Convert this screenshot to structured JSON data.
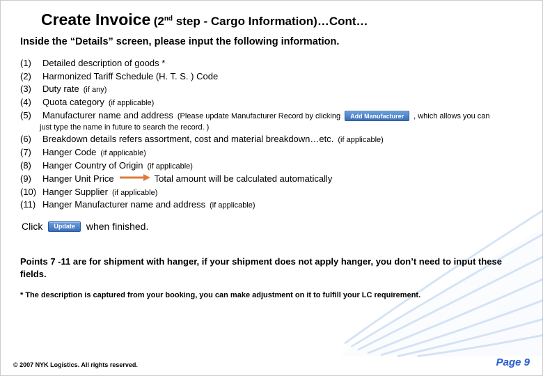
{
  "title": {
    "main": "Create Invoice",
    "sub_prefix": "(2",
    "sub_ord": "nd",
    "sub_rest": " step - Cargo Information)…Cont…"
  },
  "intro": "Inside the “Details” screen, please input the following information.",
  "items": [
    {
      "num": "(1)",
      "text": "Detailed description of goods *"
    },
    {
      "num": "(2)",
      "text": "Harmonized Tariff Schedule (H. T. S. ) Code"
    },
    {
      "num": "(3)",
      "text": "Duty rate",
      "paren": "(if any)"
    },
    {
      "num": "(4)",
      "text": "Quota category",
      "paren": "(if applicable)"
    },
    {
      "num": "(5)",
      "text": "Manufacturer name and address",
      "paren": "(Please update Manufacturer Record by clicking",
      "after_btn": ", which allows you can"
    },
    {
      "num": "(6)",
      "text": "Breakdown details refers assortment, cost and material breakdown…etc.",
      "paren": "(if applicable)"
    },
    {
      "num": "(7)",
      "text": "Hanger Code",
      "paren": "(if applicable)"
    },
    {
      "num": "(8)",
      "text": "Hanger Country of Origin",
      "paren": "(if applicable)"
    },
    {
      "num": "(9)",
      "text": "Hanger Unit Price",
      "after_arrow": "Total amount will be calculated automatically"
    },
    {
      "num": "(10)",
      "text": "Hanger Supplier",
      "paren": "(if applicable)"
    },
    {
      "num": "(11)",
      "text": "Hanger Manufacturer name and address",
      "paren": "(if applicable)"
    }
  ],
  "note5": "just type the name in future to search the record. )",
  "buttons": {
    "add_manufacturer": "Add Manufacturer",
    "update": "Update"
  },
  "click_row": {
    "prefix": "Click",
    "suffix": "when finished."
  },
  "points": "Points 7 -11 are for shipment with hanger, if your shipment does not apply hanger, you don’t need to input these fields.",
  "footnote": "* The description is captured from your booking, you can make adjustment on it to fulfill your LC requirement.",
  "footer": {
    "copyright": "© 2007 NYK Logistics. All rights reserved.",
    "page": "Page 9"
  }
}
